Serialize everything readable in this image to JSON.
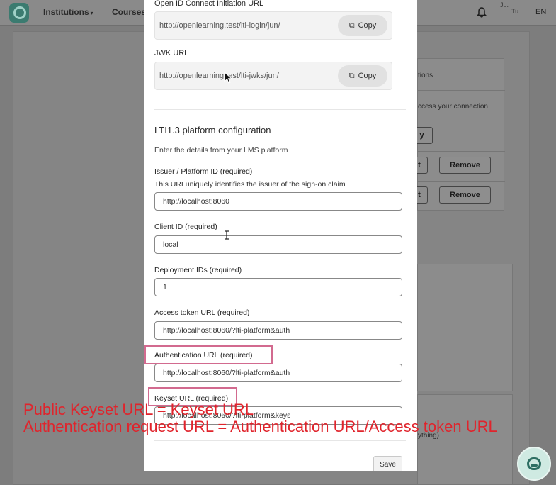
{
  "nav": {
    "items": [
      {
        "label": "Institutions",
        "caret": "▾"
      },
      {
        "label": "Courses",
        "caret": "▾"
      }
    ],
    "user_label_1": "Ju.",
    "user_label_2": "Tu",
    "language": "EN"
  },
  "background": {
    "panel_tab_text": "tions",
    "panel_desc_text": "ccess your connection",
    "copy_frag": "y",
    "row_action": "t",
    "remove_label": "Remove",
    "lower_text": "ything)"
  },
  "modal": {
    "oidc": {
      "label": "Open ID Connect Initiation URL",
      "value": "http://openlearning.test/lti-login/jun/",
      "copy_label": "Copy"
    },
    "jwk": {
      "label": "JWK URL",
      "value": "http://openlearning.test/lti-jwks/jun/",
      "copy_label": "Copy"
    },
    "section_title": "LTI1.3 platform configuration",
    "section_subtitle": "Enter the details from your LMS platform",
    "fields": {
      "issuer": {
        "label": "Issuer / Platform ID (required)",
        "help": "This URI uniquely identifies the issuer of the sign-on claim",
        "value": "http://localhost:8060"
      },
      "client_id": {
        "label": "Client ID (required)",
        "value": "local"
      },
      "deployment": {
        "label": "Deployment IDs (required)",
        "value": "1"
      },
      "access_token": {
        "label": "Access token URL (required)",
        "value": "http://localhost:8060/?lti-platform&auth"
      },
      "authentication": {
        "label": "Authentication URL (required)",
        "value": "http://localhost:8060/?lti-platform&auth"
      },
      "keyset": {
        "label": "Keyset URL (required)",
        "value": "http://localhost:8060/?lti-platform&keys"
      }
    },
    "save_label": "Save"
  },
  "annotations": {
    "line1": "Public Keyset URL = Keyset URL",
    "line2": "Authentication request URL = Authentication URL/Access token URL"
  },
  "colors": {
    "highlight": "#d26a8f",
    "annotation": "#e0242c",
    "brand": "#3b7b70"
  }
}
